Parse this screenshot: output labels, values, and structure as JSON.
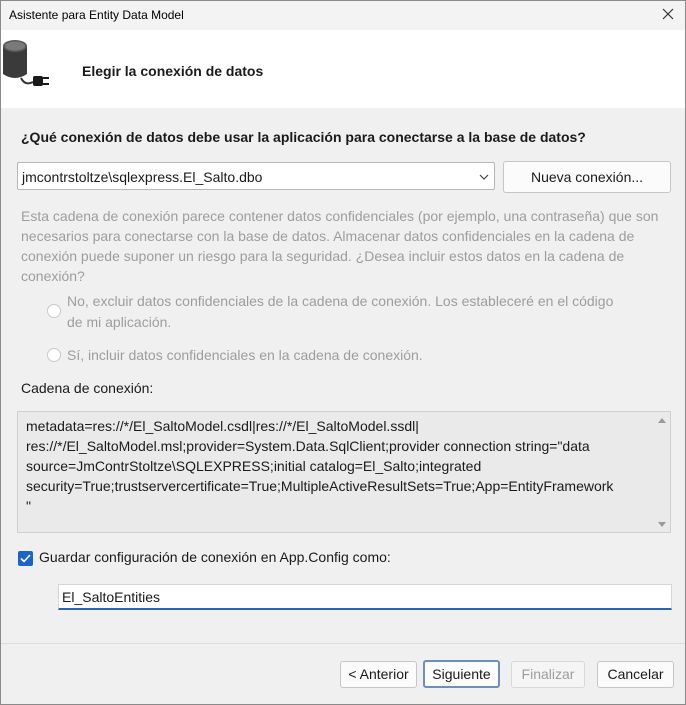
{
  "window": {
    "title": "Asistente para Entity Data Model"
  },
  "header": {
    "title": "Elegir la conexión de datos"
  },
  "question": "¿Qué conexión de datos debe usar la aplicación para conectarse a la base de datos?",
  "connection_select": {
    "value": "jmcontrstoltze\\sqlexpress.El_Salto.dbo"
  },
  "new_connection_label": "Nueva conexión...",
  "warning_text": "Esta cadena de conexión parece contener datos confidenciales (por ejemplo, una contraseña) que son necesarios para conectarse con la base de datos. Almacenar datos confidenciales en la cadena de conexión puede suponer un riesgo para la seguridad. ¿Desea incluir estos datos en la cadena de conexión?",
  "radio_options": [
    {
      "label_line1": "No, excluir datos confidenciales de la cadena de conexión. Los estableceré en el código",
      "label_line2": "de mi aplicación."
    },
    {
      "label": "Sí, incluir datos confidenciales en la cadena de conexión."
    }
  ],
  "connection_string_label": "Cadena de conexión:",
  "connection_string_lines": [
    "metadata=res://*/El_SaltoModel.csdl|res://*/El_SaltoModel.ssdl|",
    "res://*/El_SaltoModel.msl;provider=System.Data.SqlClient;provider connection string=\"data",
    "source=JmContrStoltze\\SQLEXPRESS;initial catalog=El_Salto;integrated",
    "security=True;trustservercertificate=True;MultipleActiveResultSets=True;App=EntityFramework",
    "\""
  ],
  "save_config": {
    "checked": true,
    "label": "Guardar configuración de conexión en App.Config como:"
  },
  "entities_name": {
    "value": "El_SaltoEntities"
  },
  "buttons": {
    "back": "< Anterior",
    "next": "Siguiente",
    "finish": "Finalizar",
    "cancel": "Cancelar"
  },
  "colors": {
    "accent": "#1c64c8",
    "disabled_text": "#9d9d9d"
  },
  "icons": {
    "header": "database-connection-icon",
    "close": "close-icon"
  }
}
